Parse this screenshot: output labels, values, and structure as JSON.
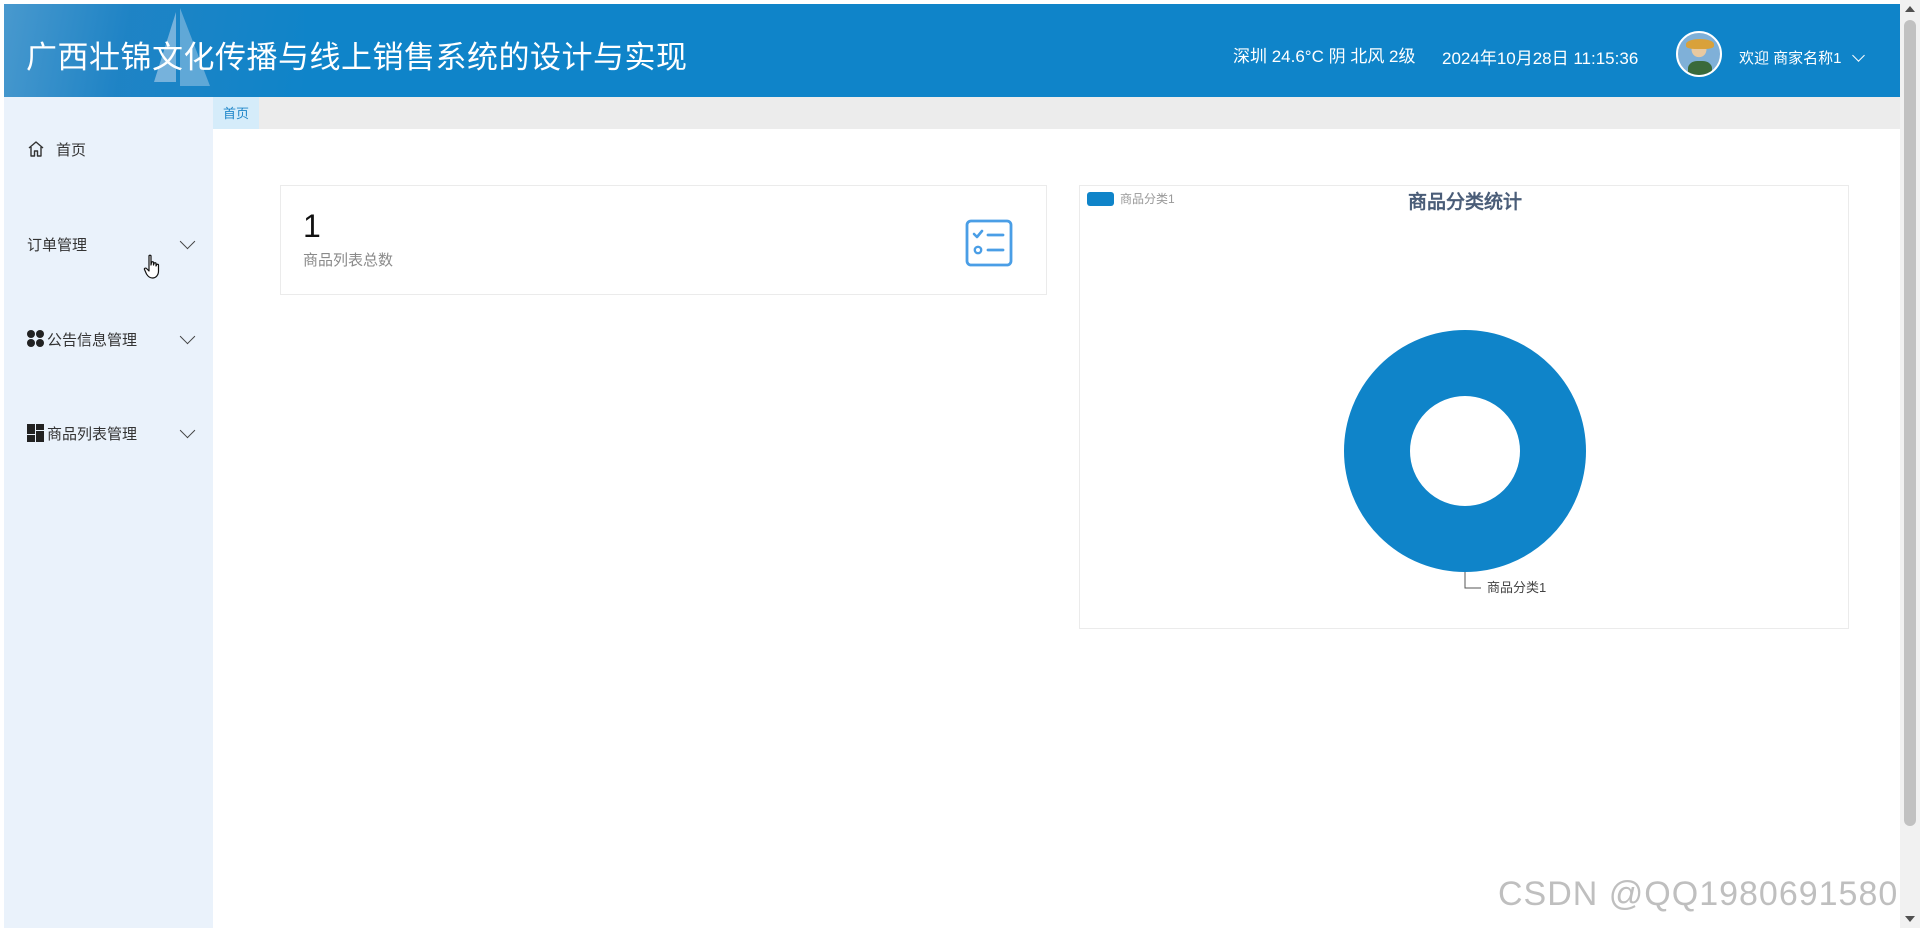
{
  "header": {
    "title": "广西壮锦文化传播与线上销售系统的设计与实现",
    "weather": "深圳 24.6°C 阴 北风 2级",
    "datetime": "2024年10月28日 11:15:36",
    "user_label": "欢迎 商家名称1"
  },
  "sidebar": {
    "items": [
      {
        "label": "首页",
        "icon": "home-icon"
      },
      {
        "label": "订单管理",
        "icon": ""
      },
      {
        "label": "公告信息管理",
        "icon": "dots-icon"
      },
      {
        "label": "商品列表管理",
        "icon": "grid-icon"
      }
    ]
  },
  "breadcrumb": {
    "tab": "首页"
  },
  "stat": {
    "value": "1",
    "label": "商品列表总数",
    "icon": "checklist-icon"
  },
  "chart_data": {
    "type": "pie",
    "title": "商品分类统计",
    "categories": [
      "商品分类1"
    ],
    "values": [
      1
    ],
    "legend": [
      "商品分类1"
    ],
    "legend_position": "top-left",
    "donut": true,
    "colors": [
      "#0f84c9"
    ]
  },
  "watermark": "CSDN @QQ1980691580",
  "colors": {
    "header": "#0f84c9",
    "sidebar": "#eaf2fb",
    "accent": "#1e86c9"
  }
}
